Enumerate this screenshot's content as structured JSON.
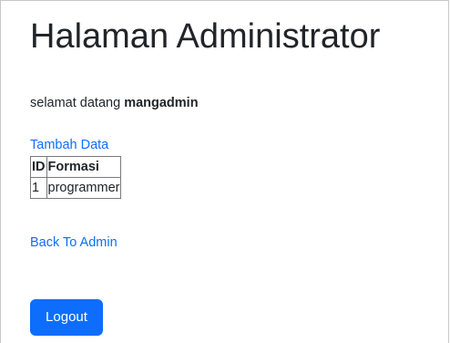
{
  "page": {
    "title": "Halaman Administrator"
  },
  "welcome": {
    "prefix": "selamat datang ",
    "username": "mangadmin"
  },
  "links": {
    "add_data": "Tambah Data",
    "back_to_admin": "Back To Admin"
  },
  "table": {
    "headers": [
      "ID",
      "Formasi"
    ],
    "rows": [
      [
        "1",
        "programmer"
      ]
    ]
  },
  "buttons": {
    "logout": "Logout"
  },
  "colors": {
    "link": "#0d6efd",
    "button_bg": "#0d6efd",
    "button_text": "#ffffff",
    "text": "#212529"
  }
}
